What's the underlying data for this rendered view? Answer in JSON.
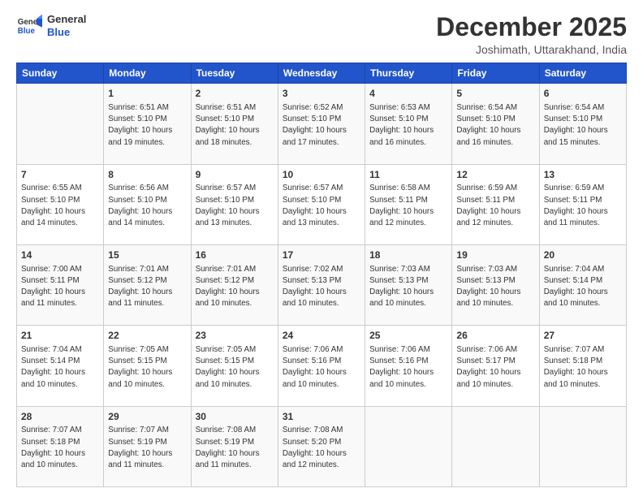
{
  "header": {
    "logo_general": "General",
    "logo_blue": "Blue",
    "title": "December 2025",
    "subtitle": "Joshimath, Uttarakhand, India"
  },
  "calendar": {
    "weekdays": [
      "Sunday",
      "Monday",
      "Tuesday",
      "Wednesday",
      "Thursday",
      "Friday",
      "Saturday"
    ],
    "rows": [
      [
        {
          "day": "",
          "info": ""
        },
        {
          "day": "1",
          "info": "Sunrise: 6:51 AM\nSunset: 5:10 PM\nDaylight: 10 hours\nand 19 minutes."
        },
        {
          "day": "2",
          "info": "Sunrise: 6:51 AM\nSunset: 5:10 PM\nDaylight: 10 hours\nand 18 minutes."
        },
        {
          "day": "3",
          "info": "Sunrise: 6:52 AM\nSunset: 5:10 PM\nDaylight: 10 hours\nand 17 minutes."
        },
        {
          "day": "4",
          "info": "Sunrise: 6:53 AM\nSunset: 5:10 PM\nDaylight: 10 hours\nand 16 minutes."
        },
        {
          "day": "5",
          "info": "Sunrise: 6:54 AM\nSunset: 5:10 PM\nDaylight: 10 hours\nand 16 minutes."
        },
        {
          "day": "6",
          "info": "Sunrise: 6:54 AM\nSunset: 5:10 PM\nDaylight: 10 hours\nand 15 minutes."
        }
      ],
      [
        {
          "day": "7",
          "info": "Sunrise: 6:55 AM\nSunset: 5:10 PM\nDaylight: 10 hours\nand 14 minutes."
        },
        {
          "day": "8",
          "info": "Sunrise: 6:56 AM\nSunset: 5:10 PM\nDaylight: 10 hours\nand 14 minutes."
        },
        {
          "day": "9",
          "info": "Sunrise: 6:57 AM\nSunset: 5:10 PM\nDaylight: 10 hours\nand 13 minutes."
        },
        {
          "day": "10",
          "info": "Sunrise: 6:57 AM\nSunset: 5:10 PM\nDaylight: 10 hours\nand 13 minutes."
        },
        {
          "day": "11",
          "info": "Sunrise: 6:58 AM\nSunset: 5:11 PM\nDaylight: 10 hours\nand 12 minutes."
        },
        {
          "day": "12",
          "info": "Sunrise: 6:59 AM\nSunset: 5:11 PM\nDaylight: 10 hours\nand 12 minutes."
        },
        {
          "day": "13",
          "info": "Sunrise: 6:59 AM\nSunset: 5:11 PM\nDaylight: 10 hours\nand 11 minutes."
        }
      ],
      [
        {
          "day": "14",
          "info": "Sunrise: 7:00 AM\nSunset: 5:11 PM\nDaylight: 10 hours\nand 11 minutes."
        },
        {
          "day": "15",
          "info": "Sunrise: 7:01 AM\nSunset: 5:12 PM\nDaylight: 10 hours\nand 11 minutes."
        },
        {
          "day": "16",
          "info": "Sunrise: 7:01 AM\nSunset: 5:12 PM\nDaylight: 10 hours\nand 10 minutes."
        },
        {
          "day": "17",
          "info": "Sunrise: 7:02 AM\nSunset: 5:13 PM\nDaylight: 10 hours\nand 10 minutes."
        },
        {
          "day": "18",
          "info": "Sunrise: 7:03 AM\nSunset: 5:13 PM\nDaylight: 10 hours\nand 10 minutes."
        },
        {
          "day": "19",
          "info": "Sunrise: 7:03 AM\nSunset: 5:13 PM\nDaylight: 10 hours\nand 10 minutes."
        },
        {
          "day": "20",
          "info": "Sunrise: 7:04 AM\nSunset: 5:14 PM\nDaylight: 10 hours\nand 10 minutes."
        }
      ],
      [
        {
          "day": "21",
          "info": "Sunrise: 7:04 AM\nSunset: 5:14 PM\nDaylight: 10 hours\nand 10 minutes."
        },
        {
          "day": "22",
          "info": "Sunrise: 7:05 AM\nSunset: 5:15 PM\nDaylight: 10 hours\nand 10 minutes."
        },
        {
          "day": "23",
          "info": "Sunrise: 7:05 AM\nSunset: 5:15 PM\nDaylight: 10 hours\nand 10 minutes."
        },
        {
          "day": "24",
          "info": "Sunrise: 7:06 AM\nSunset: 5:16 PM\nDaylight: 10 hours\nand 10 minutes."
        },
        {
          "day": "25",
          "info": "Sunrise: 7:06 AM\nSunset: 5:16 PM\nDaylight: 10 hours\nand 10 minutes."
        },
        {
          "day": "26",
          "info": "Sunrise: 7:06 AM\nSunset: 5:17 PM\nDaylight: 10 hours\nand 10 minutes."
        },
        {
          "day": "27",
          "info": "Sunrise: 7:07 AM\nSunset: 5:18 PM\nDaylight: 10 hours\nand 10 minutes."
        }
      ],
      [
        {
          "day": "28",
          "info": "Sunrise: 7:07 AM\nSunset: 5:18 PM\nDaylight: 10 hours\nand 10 minutes."
        },
        {
          "day": "29",
          "info": "Sunrise: 7:07 AM\nSunset: 5:19 PM\nDaylight: 10 hours\nand 11 minutes."
        },
        {
          "day": "30",
          "info": "Sunrise: 7:08 AM\nSunset: 5:19 PM\nDaylight: 10 hours\nand 11 minutes."
        },
        {
          "day": "31",
          "info": "Sunrise: 7:08 AM\nSunset: 5:20 PM\nDaylight: 10 hours\nand 12 minutes."
        },
        {
          "day": "",
          "info": ""
        },
        {
          "day": "",
          "info": ""
        },
        {
          "day": "",
          "info": ""
        }
      ]
    ]
  }
}
